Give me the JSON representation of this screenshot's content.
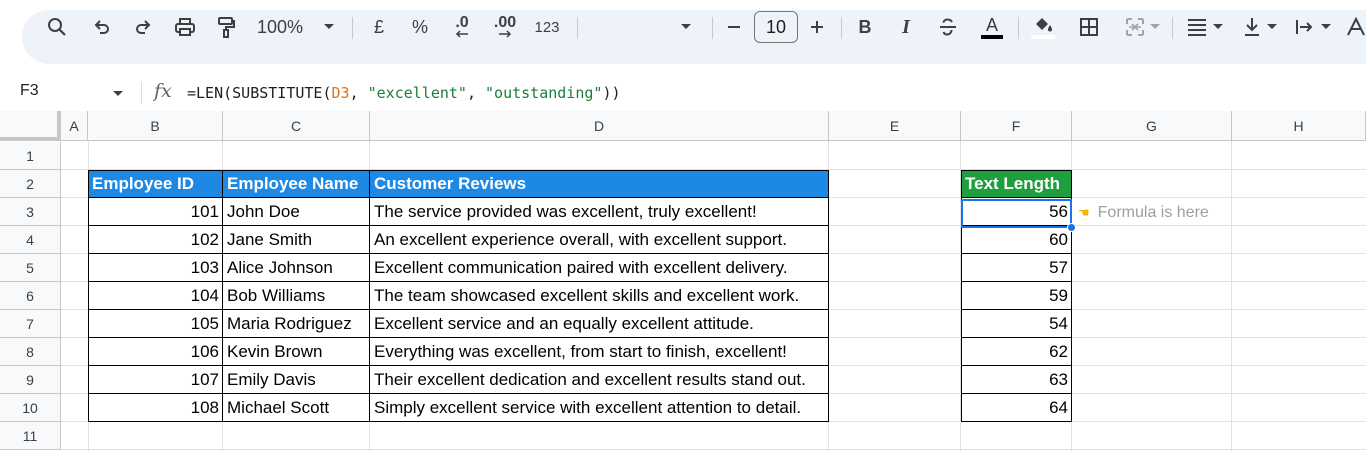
{
  "toolbar": {
    "zoom": "100%",
    "currency": "£",
    "percent": "%",
    "decrease_decimals": ".0",
    "increase_decimals": ".00",
    "number_format": "123",
    "font_size": "10",
    "bold": "B",
    "italic": "I",
    "text_color": "A",
    "icons": [
      "search-icon",
      "undo-icon",
      "redo-icon",
      "print-icon",
      "paint-format-icon",
      "zoom-dropdown-icon",
      "minus-icon",
      "plus-icon",
      "strikethrough-icon",
      "fill-color-icon",
      "borders-icon",
      "merge-cells-icon",
      "align-icon",
      "vertical-align-icon",
      "text-wrap-icon",
      "text-rotation-icon"
    ]
  },
  "formula_bar": {
    "name_box": "F3",
    "fx": "fx",
    "formula_prefix": "=LEN(SUBSTITUTE(",
    "formula_ref": "D3",
    "formula_sep1": ", ",
    "formula_arg1": "\"excellent\"",
    "formula_sep2": ", ",
    "formula_arg2": "\"outstanding\"",
    "formula_suffix": "))"
  },
  "columns": [
    "A",
    "B",
    "C",
    "D",
    "E",
    "F",
    "G",
    "H"
  ],
  "rows": [
    "1",
    "2",
    "3",
    "4",
    "5",
    "6",
    "7",
    "8",
    "9",
    "10",
    "11"
  ],
  "table": {
    "headers": [
      "Employee ID",
      "Employee Name",
      "Customer Reviews"
    ],
    "rows": [
      [
        "101",
        "John Doe",
        "The service provided was excellent, truly excellent!"
      ],
      [
        "102",
        "Jane Smith",
        "An excellent experience overall, with excellent support."
      ],
      [
        "103",
        "Alice Johnson",
        "Excellent communication paired with excellent delivery."
      ],
      [
        "104",
        "Bob Williams",
        "The team showcased excellent skills and excellent work."
      ],
      [
        "105",
        "Maria Rodriguez",
        "Excellent service and an equally excellent attitude."
      ],
      [
        "106",
        "Kevin Brown",
        "Everything was excellent, from start to finish, excellent!"
      ],
      [
        "107",
        "Emily Davis",
        "Their excellent dedication and excellent results stand out."
      ],
      [
        "108",
        "Michael Scott",
        "Simply excellent service with excellent attention to detail."
      ]
    ]
  },
  "result": {
    "header": "Text Length",
    "values": [
      "56",
      "60",
      "57",
      "59",
      "54",
      "62",
      "63",
      "64"
    ]
  },
  "note": "Formula is here",
  "colors": {
    "header_blue": "#1e88e5",
    "header_green": "#1e9e3c",
    "selection": "#1a73e8"
  }
}
